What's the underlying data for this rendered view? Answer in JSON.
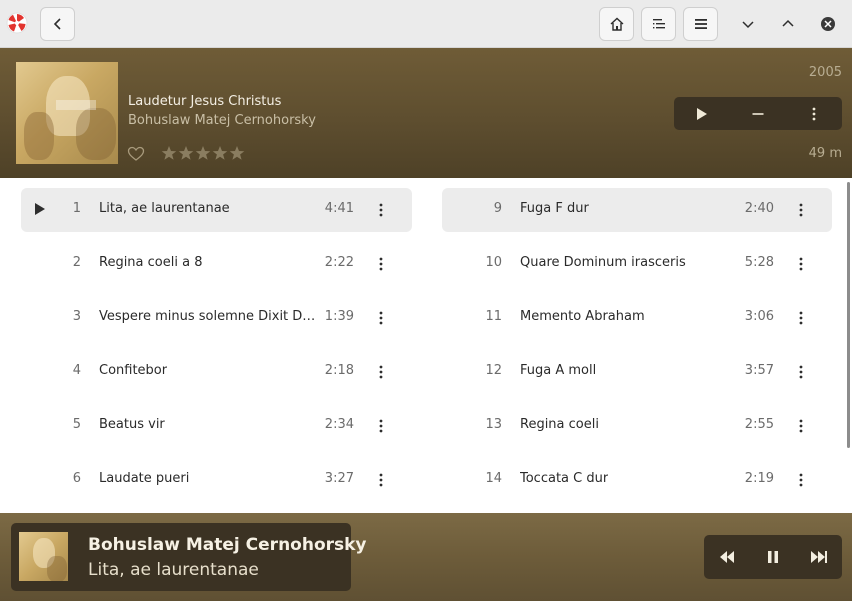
{
  "header": {
    "app_icon": "app-logo-icon",
    "back_icon": "chevron-left-icon",
    "home_icon": "home-icon",
    "queue_icon": "playlist-icon",
    "menu_icon": "hamburger-icon",
    "minimize_icon": "chevron-down-icon",
    "maximize_icon": "chevron-up-icon",
    "close_icon": "close-icon"
  },
  "album": {
    "title": "Laudetur Jesus Christus",
    "artist": "Bohuslaw Matej Cernohorsky",
    "year": "2005",
    "duration": "49 m",
    "rating": 0,
    "max_rating": 5,
    "favorite": false
  },
  "tracks_left": [
    {
      "number": "1",
      "title": "Lita, ae laurentanae",
      "duration": "4:41",
      "active": true
    },
    {
      "number": "2",
      "title": "Regina coeli a 8",
      "duration": "2:22"
    },
    {
      "number": "3",
      "title": "Vespere minus solemne Dixit Dominus",
      "duration": "1:39"
    },
    {
      "number": "4",
      "title": "Confitebor",
      "duration": "2:18"
    },
    {
      "number": "5",
      "title": "Beatus vir",
      "duration": "2:34"
    },
    {
      "number": "6",
      "title": "Laudate pueri",
      "duration": "3:27"
    }
  ],
  "tracks_right": [
    {
      "number": "9",
      "title": "Fuga F dur",
      "duration": "2:40",
      "hover": true
    },
    {
      "number": "10",
      "title": "Quare Dominum irasceris",
      "duration": "5:28"
    },
    {
      "number": "11",
      "title": "Memento Abraham",
      "duration": "3:06"
    },
    {
      "number": "12",
      "title": "Fuga A moll",
      "duration": "3:57"
    },
    {
      "number": "13",
      "title": "Regina coeli",
      "duration": "2:55"
    },
    {
      "number": "14",
      "title": "Toccata C dur",
      "duration": "2:19"
    }
  ],
  "now_playing": {
    "artist": "Bohuslaw Matej Cernohorsky",
    "track": "Lita, ae laurentanae",
    "state": "playing"
  },
  "colors": {
    "accent_dark": "#3b3223",
    "header_brown": "#6f5c37",
    "footer_brown": "#7c6a45"
  }
}
